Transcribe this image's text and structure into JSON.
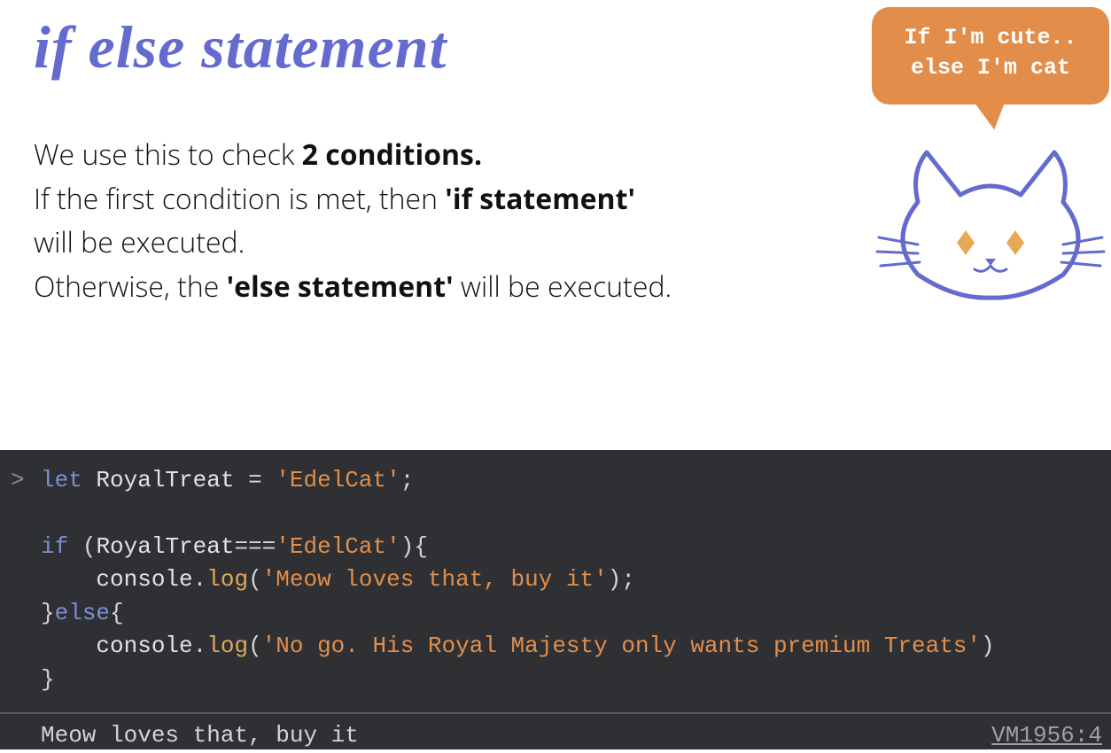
{
  "title": "if else statement",
  "description": {
    "line1_a": "We use this  to  check  ",
    "line1_b": "2 conditions.",
    "line2_a": "If the first condition is met, then ",
    "line2_b": "'if statement'",
    "line3": "will be executed.",
    "line4_a": "Otherwise, the ",
    "line4_b": "'else statement'",
    "line4_c": " will be executed."
  },
  "bubble": {
    "line1": "If I'm cute..",
    "line2": "else I'm cat"
  },
  "code": {
    "kw_let": "let",
    "var_name": "RoyalTreat",
    "assign_str": "'EdelCat'",
    "kw_if": "if",
    "compare_str": "'EdelCat'",
    "console": "console",
    "log_fn": "log",
    "log_str1": "'Meow loves that, buy it'",
    "kw_else": "else",
    "log_str2": "'No go. His Royal Majesty only wants premium Treats'"
  },
  "output": {
    "text": "Meow loves that, buy it",
    "source": "VM1956:4"
  }
}
